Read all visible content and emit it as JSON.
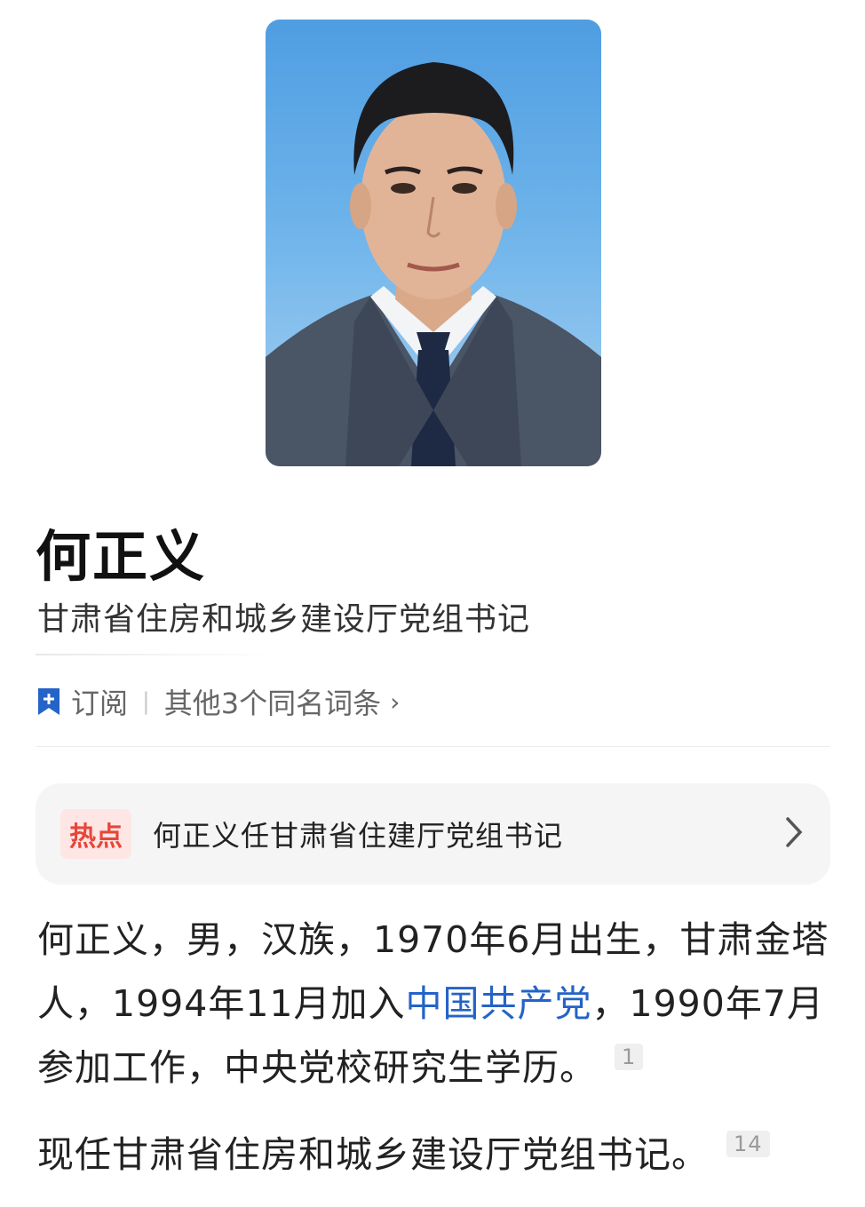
{
  "profile": {
    "name": "何正义",
    "title": "甘肃省住房和城乡建设厅党组书记"
  },
  "actions": {
    "subscribe_label": "订阅",
    "separator": "|",
    "homonyms_label": "其他3个同名词条",
    "chevron": "›"
  },
  "hot": {
    "badge": "热点",
    "headline": "何正义任甘肃省住建厅党组书记"
  },
  "bio": {
    "p1_part1": "何正义，男，汉族，1970年6月出生，甘肃金塔人，1994年11月加入",
    "p1_link": "中国共产党",
    "p1_part2": "，1990年7月参加工作，中央党校研究生学历。",
    "p1_cite": "1",
    "p2_text": "现任甘肃省住房和城乡建设厅党组书记。",
    "p2_cite": "14"
  },
  "colors": {
    "link": "#2463c8",
    "hot_badge_text": "#e8463a",
    "hot_badge_bg": "#fde6e4",
    "bookmark_icon": "#2463c8",
    "portrait_bg": "#5aa5e5"
  }
}
